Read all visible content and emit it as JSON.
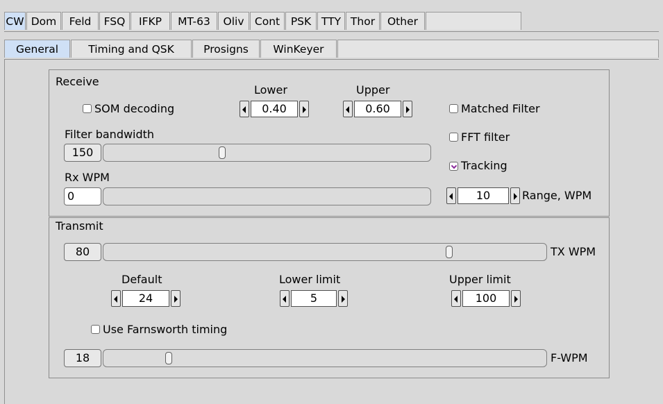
{
  "mode_tabs": [
    "CW",
    "Dom",
    "Feld",
    "FSQ",
    "IFKP",
    "MT-63",
    "Oliv",
    "Cont",
    "PSK",
    "TTY",
    "Thor",
    "Other"
  ],
  "sub_tabs": [
    "General",
    "Timing and QSK",
    "Prosigns",
    "WinKeyer"
  ],
  "receive": {
    "title": "Receive",
    "som_label": "SOM decoding",
    "som_checked": false,
    "lower_label": "Lower",
    "lower_value": "0.40",
    "upper_label": "Upper",
    "upper_value": "0.60",
    "matched_filter_label": "Matched Filter",
    "matched_filter_checked": false,
    "filter_bw_label": "Filter bandwidth",
    "filter_bw_value": "150",
    "fft_filter_label": "FFT filter",
    "fft_filter_checked": false,
    "tracking_label": "Tracking",
    "tracking_checked": true,
    "rx_wpm_label": "Rx WPM",
    "rx_wpm_value": "0",
    "range_value": "10",
    "range_label": "Range, WPM"
  },
  "transmit": {
    "title": "Transmit",
    "tx_wpm_value": "80",
    "tx_wpm_label": "TX WPM",
    "default_label": "Default",
    "default_value": "24",
    "lower_limit_label": "Lower limit",
    "lower_limit_value": "5",
    "upper_limit_label": "Upper limit",
    "upper_limit_value": "100",
    "farnsworth_label": "Use Farnsworth timing",
    "farnsworth_checked": false,
    "fwpm_value": "18",
    "fwpm_label": "F-WPM"
  }
}
